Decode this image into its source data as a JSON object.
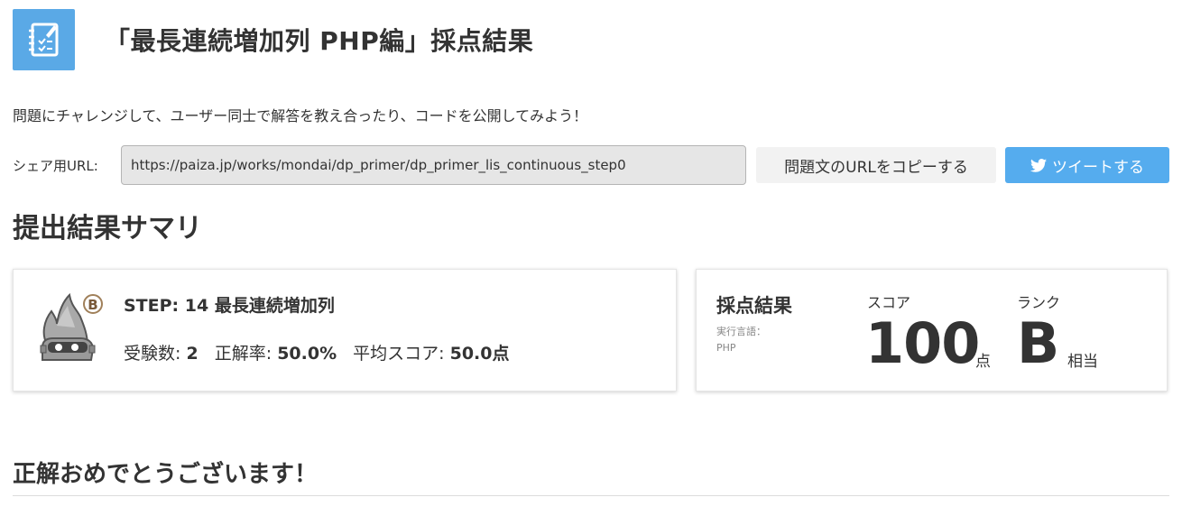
{
  "header": {
    "title": "「最長連続増加列 PHP編」採点結果",
    "logo_icon": "checklist-notebook-icon"
  },
  "intro_text": "問題にチャレンジして、ユーザー同士で解答を教え合ったり、コードを公開してみよう！",
  "share": {
    "label": "シェア用URL:",
    "url": "https://paiza.jp/works/mondai/dp_primer/dp_primer_lis_continuous_step0",
    "copy_label": "問題文のURLをコピーする",
    "tweet_label": "ツイートする"
  },
  "summary": {
    "title": "提出結果サマリ",
    "step_title": "STEP: 14 最長連続増加列",
    "mascot_rank_badge": "B",
    "examinees_label": "受験数:",
    "examinees_value": "2",
    "accuracy_label": "正解率:",
    "accuracy_value": "50.0%",
    "avg_label": "平均スコア:",
    "avg_value": "50.0点"
  },
  "result": {
    "title": "採点結果",
    "lang_label": "実行言語：",
    "lang_value": "PHP",
    "score_label": "スコア",
    "score_value": "100",
    "score_unit": "点",
    "rank_label": "ランク",
    "rank_value": "B",
    "rank_unit": "相当"
  },
  "congrats": "正解おめでとうございます！",
  "colors": {
    "accent": "#5aa9e6",
    "twitter": "#55acee",
    "text": "#333333"
  }
}
